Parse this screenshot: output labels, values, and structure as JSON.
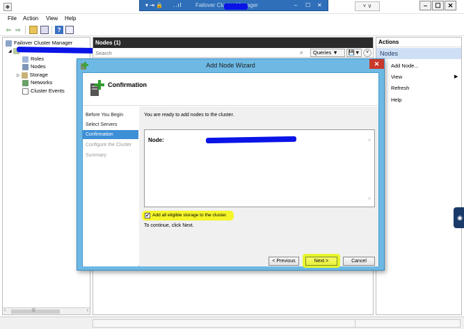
{
  "window": {
    "rdp_title": "Failover Cluster Manager",
    "rdp_controls": [
      "–",
      "☐",
      "✕"
    ],
    "rdp_left_icons": [
      "▾",
      "⇥",
      "🔒"
    ],
    "rdp_bars": "..ıl",
    "scroll_chevrons": "˅ ∨",
    "controls": {
      "minimize": "–",
      "maximize": "☐",
      "close": "✕"
    }
  },
  "menu": [
    "File",
    "Action",
    "View",
    "Help"
  ],
  "toolbar": {
    "icons": [
      "back-arrow-icon",
      "forward-arrow-icon",
      "folder-up-icon",
      "view-icon",
      "help-icon",
      "properties-icon"
    ],
    "back": "⇦",
    "forward": "⇨",
    "help": "?"
  },
  "tree": {
    "root": "Failover Cluster Manager",
    "children": [
      "Roles",
      "Nodes",
      "Storage",
      "Networks",
      "Cluster Events"
    ],
    "scroll_left": "‹",
    "scroll_right": "›",
    "scroll_grip": "|||"
  },
  "center": {
    "title": "Nodes (1)",
    "search_placeholder": "Search",
    "queries_label": "Queries",
    "dropdown": "▼",
    "save_glyph": "💾",
    "expand_glyph": "˅"
  },
  "actions": {
    "title": "Actions",
    "section": "Nodes",
    "items": [
      "Add Node...",
      "View",
      "Refresh",
      "Help"
    ],
    "submenu_arrow": "▶"
  },
  "wizard": {
    "title": "Add Node Wizard",
    "close_glyph": "✕",
    "page_title": "Confirmation",
    "steps": [
      {
        "label": "Before You Begin",
        "state": "normal"
      },
      {
        "label": "Select Servers",
        "state": "normal"
      },
      {
        "label": "Confirmation",
        "state": "active"
      },
      {
        "label": "Configure the Cluster",
        "state": "disabled"
      },
      {
        "label": "Summary",
        "state": "disabled"
      }
    ],
    "intro": "You are ready to add nodes to the cluster.",
    "node_label": "Node:",
    "scroll_up": "˄",
    "scroll_down": "˅",
    "checkbox_label": "Add all eligible storage to the cluster.",
    "checkbox_checked": true,
    "checkbox_mark": "✔",
    "continue_text": "To continue, click Next.",
    "buttons": {
      "previous": "< Previous",
      "next": "Next >",
      "cancel": "Cancel"
    }
  },
  "colors": {
    "wizard_frame": "#6db9e4",
    "step_active": "#3d8fd6",
    "highlight": "#f5f52a",
    "redaction": "#0a14e6",
    "close_red": "#c7392b"
  }
}
